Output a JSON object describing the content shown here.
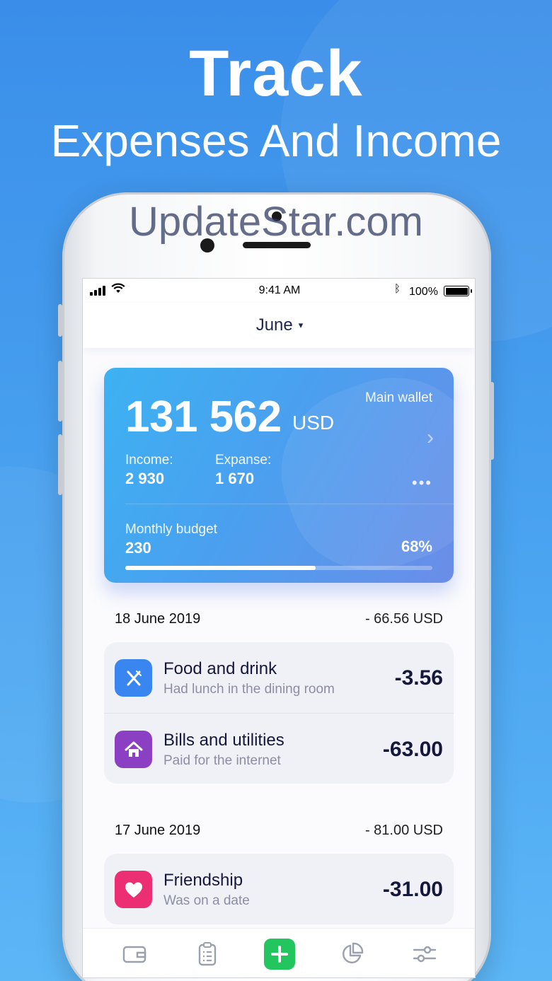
{
  "promo": {
    "headline": "Track",
    "subheadline": "Expenses And Income"
  },
  "status_bar": {
    "time": "9:41 AM",
    "battery": "100%"
  },
  "header": {
    "month": "June",
    "caret": "▾"
  },
  "wallet": {
    "amount": "131 562",
    "currency": "USD",
    "name": "Main wallet",
    "income_label": "Income:",
    "income_value": "2 930",
    "expense_label": "Expanse:",
    "expense_value": "1 670",
    "budget_label": "Monthly budget",
    "budget_value": "230",
    "budget_percent": "68%",
    "budget_progress": 0.62
  },
  "watermark": "UpdateStar.com",
  "days": [
    {
      "date": "18 June 2019",
      "total": "- 66.56 USD",
      "transactions": [
        {
          "title": "Food and drink",
          "note": "Had lunch in the dining room",
          "amount": "-3.56",
          "icon": "utensils-icon",
          "color": "#3a86f0"
        },
        {
          "title": "Bills and utilities",
          "note": "Paid for the internet",
          "amount": "-63.00",
          "icon": "house-icon",
          "color": "#8b3fc2"
        }
      ]
    },
    {
      "date": "17 June 2019",
      "total": "- 81.00 USD",
      "transactions": [
        {
          "title": "Friendship",
          "note": "Was on a date",
          "amount": "-31.00",
          "icon": "heart-icon",
          "color": "#ec2f72"
        }
      ]
    }
  ],
  "tabbar": {
    "items": [
      "wallet-icon",
      "clipboard-list-icon",
      "plus-icon",
      "pie-chart-icon",
      "sliders-icon"
    ],
    "add_color": "#22c55e"
  }
}
